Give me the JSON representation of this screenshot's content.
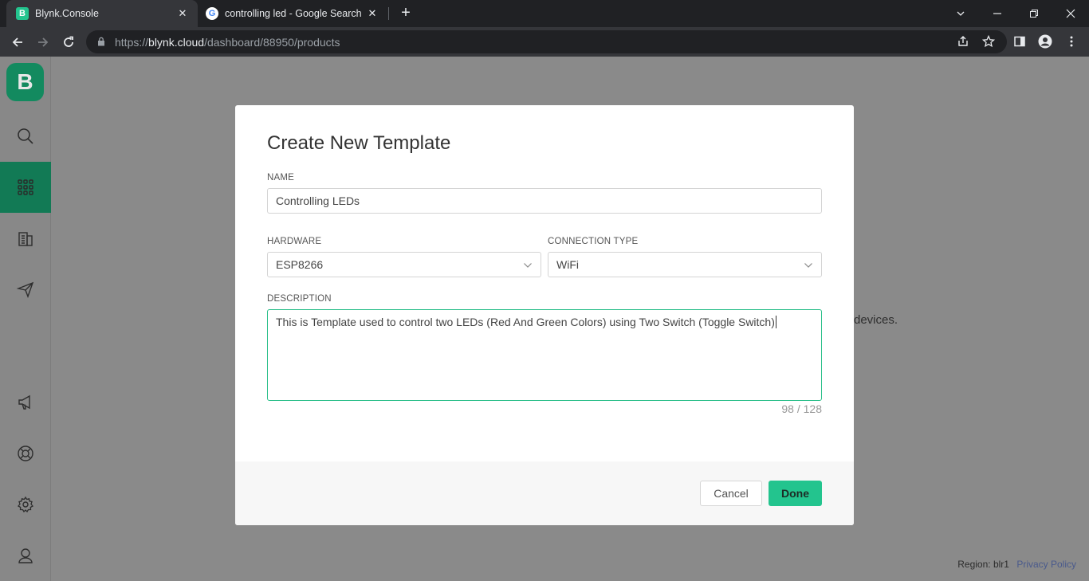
{
  "browser": {
    "tabs": [
      {
        "favicon": "B",
        "title": "Blynk.Console"
      },
      {
        "favicon": "G",
        "title": "controlling led - Google Search"
      }
    ],
    "url_prefix": "https://",
    "url_host": "blynk.cloud",
    "url_path": "/dashboard/88950/products"
  },
  "sidebar": {
    "logo": "B",
    "items": [
      {
        "icon": "search-icon"
      },
      {
        "icon": "grid-icon",
        "active": true
      },
      {
        "icon": "building-icon"
      },
      {
        "icon": "send-icon"
      },
      {
        "icon": "megaphone-icon"
      },
      {
        "icon": "lifebuoy-icon"
      },
      {
        "icon": "gear-icon"
      },
      {
        "icon": "user-icon"
      }
    ]
  },
  "background": {
    "text_fragment": "devices."
  },
  "footer": {
    "region": "Region: blr1",
    "privacy": "Privacy Policy"
  },
  "modal": {
    "title": "Create New Template",
    "name_label": "NAME",
    "name_value": "Controlling LEDs",
    "hardware_label": "HARDWARE",
    "hardware_value": "ESP8266",
    "connection_label": "CONNECTION TYPE",
    "connection_value": "WiFi",
    "description_label": "DESCRIPTION",
    "description_value": "This is  Template used to control two LEDs (Red And Green Colors) using Two Switch (Toggle Switch)",
    "char_count": "98 / 128",
    "cancel_label": "Cancel",
    "done_label": "Done"
  },
  "colors": {
    "accent": "#23c48e",
    "sidebar_active": "#127a55",
    "overlay": "#8a8a8a"
  }
}
